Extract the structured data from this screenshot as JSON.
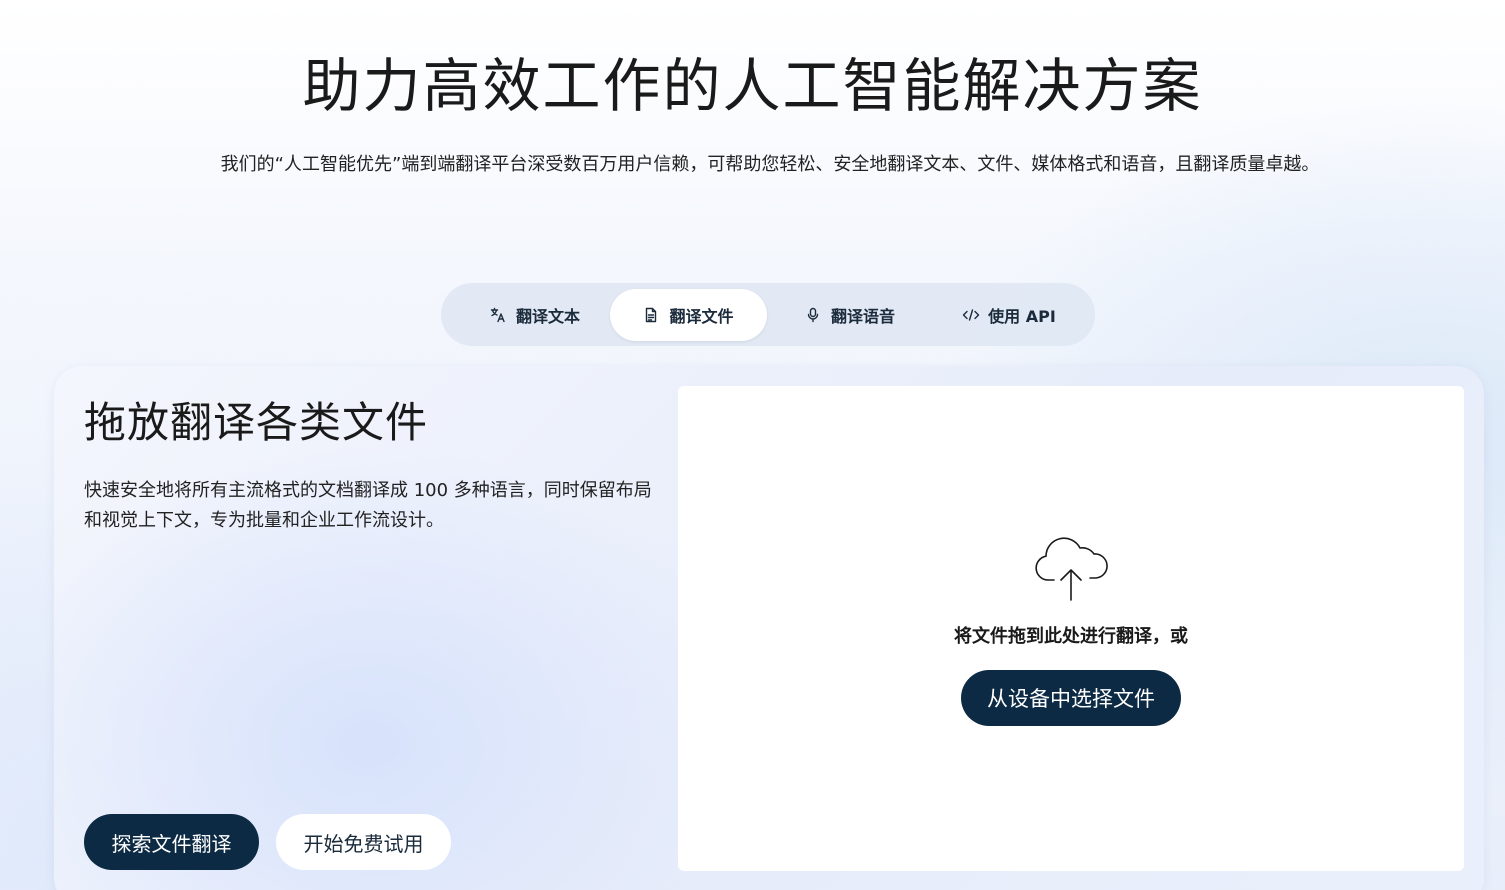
{
  "hero": {
    "title": "助力高效工作的人工智能解决方案",
    "subtitle": "我们的“人工智能优先”端到端翻译平台深受数百万用户信赖，可帮助您轻松、安全地翻译文本、文件、媒体格式和语音，且翻译质量卓越。"
  },
  "tabs": [
    {
      "label": "翻译文本",
      "icon": "translate-icon",
      "active": false
    },
    {
      "label": "翻译文件",
      "icon": "document-icon",
      "active": true
    },
    {
      "label": "翻译语音",
      "icon": "microphone-icon",
      "active": false
    },
    {
      "label": "使用 API",
      "icon": "code-icon",
      "active": false
    }
  ],
  "panel": {
    "title": "拖放翻译各类文件",
    "description": "快速安全地将所有主流格式的文档翻译成 100 多种语言，同时保留布局和视觉上下文，专为批量和企业工作流设计。",
    "explore_button": "探索文件翻译",
    "trial_button": "开始免费试用"
  },
  "dropzone": {
    "icon": "cloud-upload-icon",
    "prompt": "将文件拖到此处进行翻译，或",
    "select_button": "从设备中选择文件"
  },
  "colors": {
    "primary_dark": "#0d2a44",
    "tab_bar_bg": "#dee6f3",
    "card_bg": "#e6ecfa"
  }
}
